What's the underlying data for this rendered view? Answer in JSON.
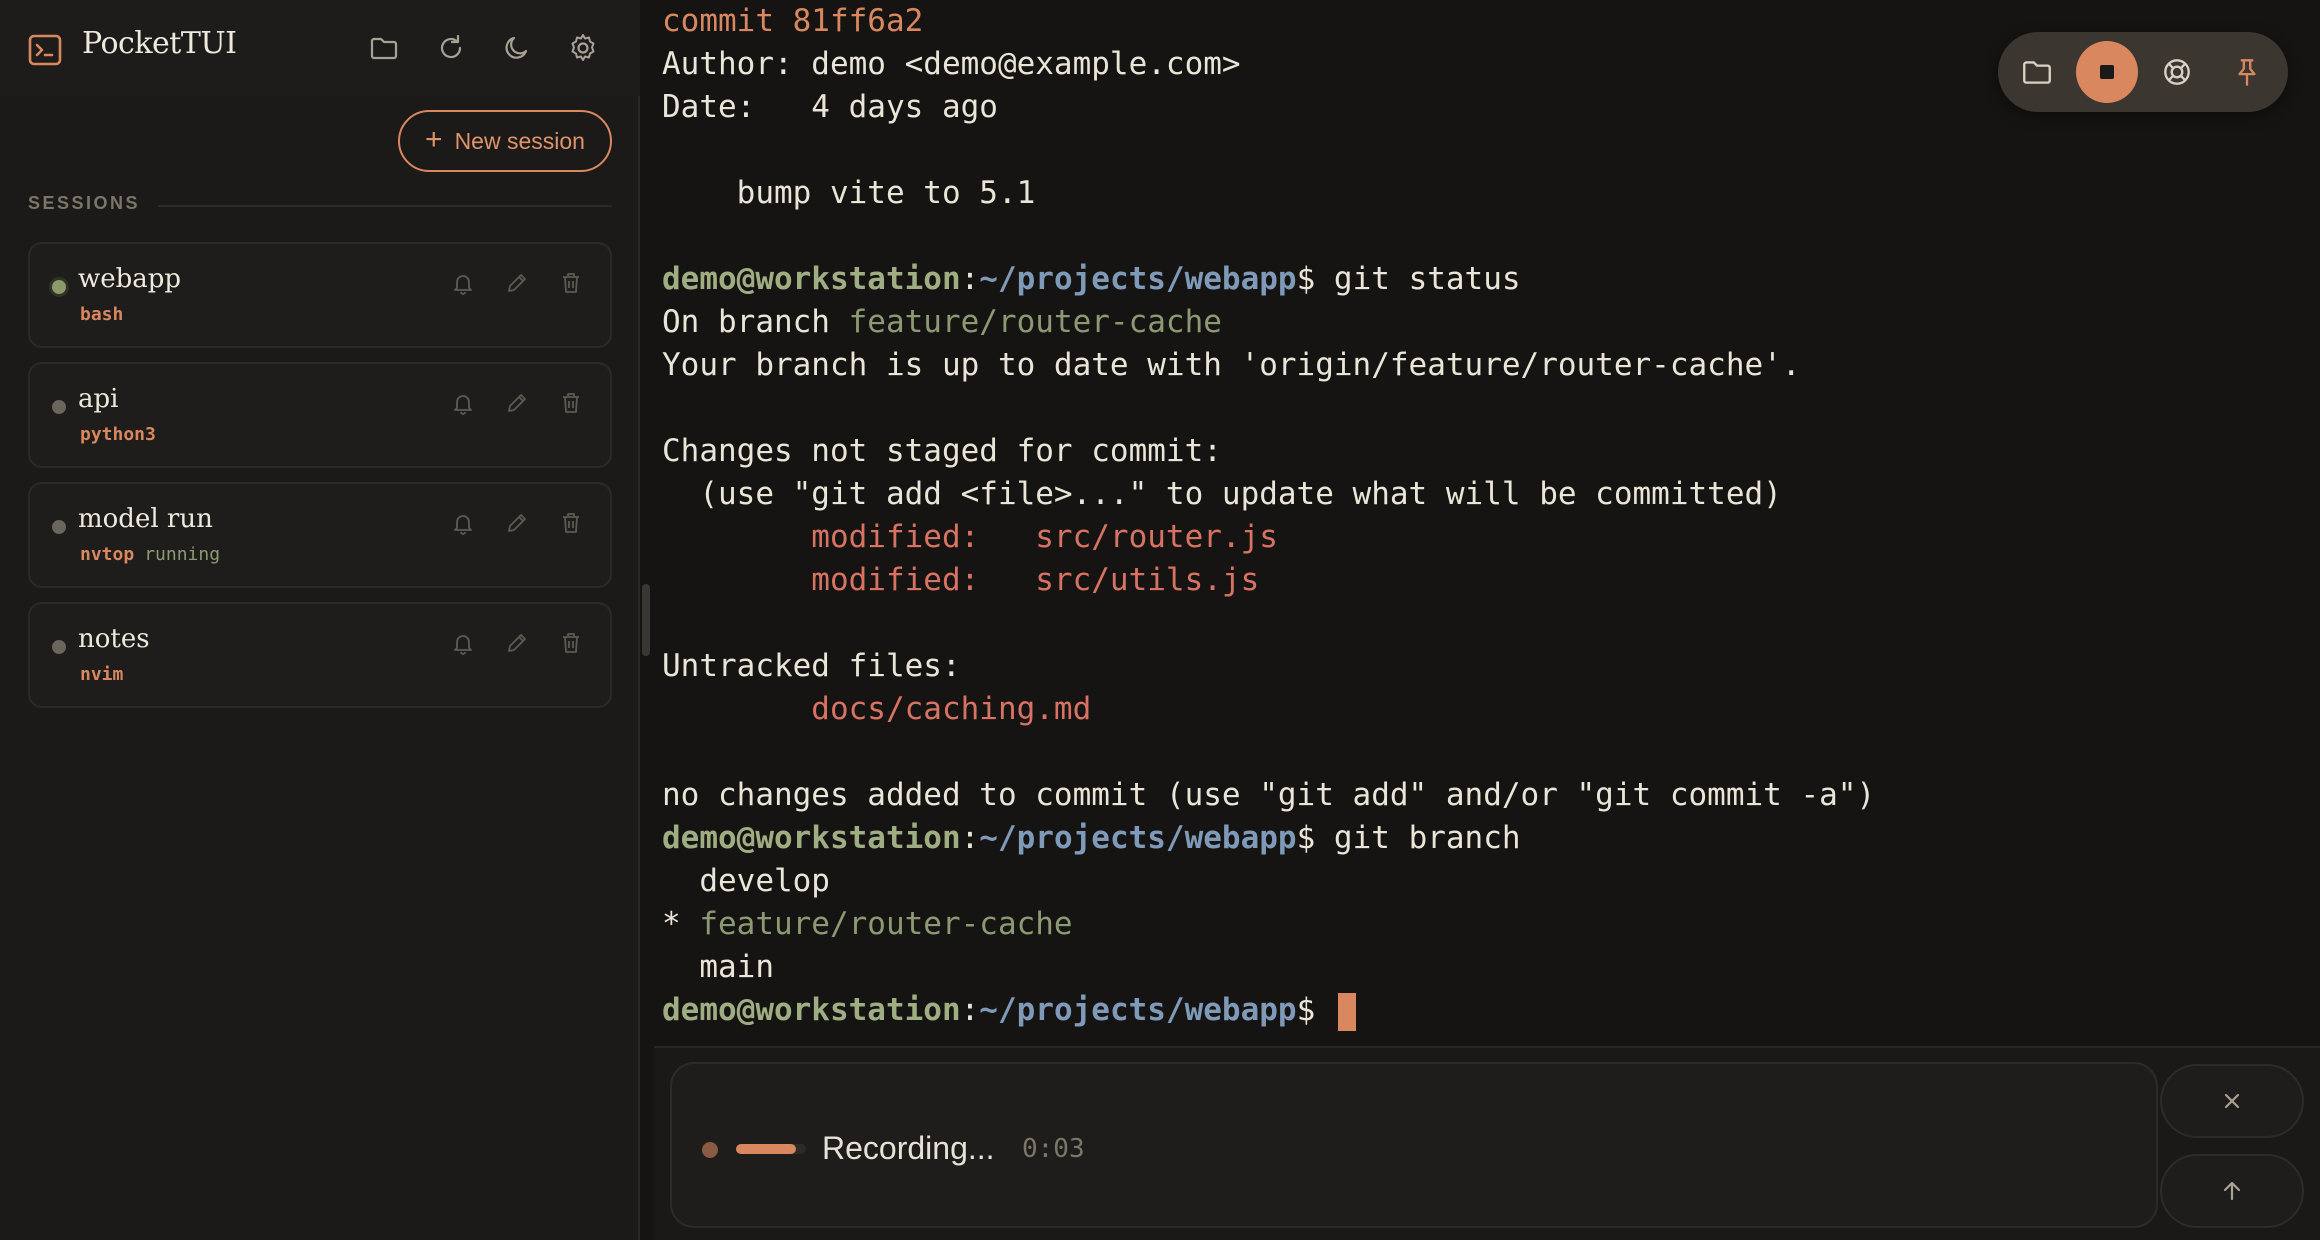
{
  "app": {
    "title": "PocketTUI",
    "accent_color": "#d8875f",
    "header_icons": [
      "folder-icon",
      "refresh-icon",
      "moon-icon",
      "gear-icon"
    ]
  },
  "sidebar": {
    "new_session_label": "New session",
    "sessions_heading": "SESSIONS",
    "sessions": [
      {
        "name": "webapp",
        "command": "bash",
        "status": "",
        "active": true
      },
      {
        "name": "api",
        "command": "python3",
        "status": "",
        "active": false
      },
      {
        "name": "model run",
        "command": "nvtop",
        "status": "running",
        "active": false
      },
      {
        "name": "notes",
        "command": "nvim",
        "status": "",
        "active": false
      }
    ],
    "card_icons": [
      "bell-icon",
      "pencil-icon",
      "trash-icon"
    ]
  },
  "terminal": {
    "prompt_user": "demo@workstation",
    "prompt_sep": ":",
    "prompt_path": "~/projects/webapp",
    "prompt_dollar": "$",
    "commit_line": "commit 81ff6a2",
    "author_line": "Author: demo <demo@example.com>",
    "date_line": "Date:   4 days ago",
    "commit_message": "    bump vite to 5.1",
    "cmd_status": " git status",
    "on_branch_prefix": "On branch ",
    "on_branch_name": "feature/router-cache",
    "up_to_date": "Your branch is up to date with 'origin/feature/router-cache'.",
    "changes_heading": "Changes not staged for commit:",
    "changes_hint": "  (use \"git add <file>...\" to update what will be committed)",
    "modified_1": "        modified:   src/router.js",
    "modified_2": "        modified:   src/utils.js",
    "untracked_heading": "Untracked files:",
    "untracked_1": "        docs/caching.md",
    "no_changes": "no changes added to commit (use \"git add\" and/or \"git commit -a\")",
    "cmd_branch": " git branch",
    "branch_develop": "  develop",
    "branch_current_marker": "* ",
    "branch_current": "feature/router-cache",
    "branch_main": "  main"
  },
  "float_toolbar": {
    "icons": [
      "folder-icon",
      "stop-icon",
      "lifebuoy-icon",
      "pin-icon"
    ]
  },
  "recorder": {
    "label": "Recording...",
    "time": "0:03",
    "progress": 0.86,
    "cancel_icon": "close-icon",
    "send_icon": "arrow-up-icon"
  }
}
